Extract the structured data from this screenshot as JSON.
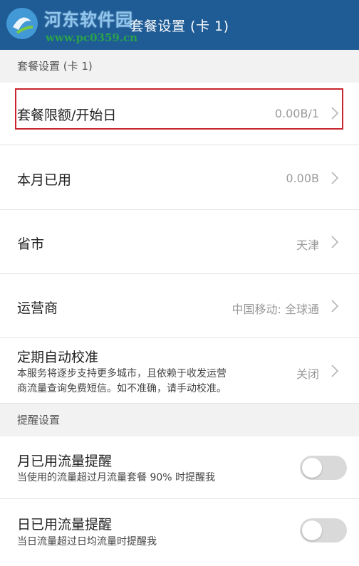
{
  "watermark": {
    "site_name": "河东软件园",
    "url": "www.pc0359.cn"
  },
  "header": {
    "title": "套餐设置 (卡 1)"
  },
  "sections": [
    {
      "header": "套餐设置 (卡 1)"
    },
    {
      "header": "提醒设置"
    }
  ],
  "rows": {
    "limit": {
      "label": "套餐限额/开始日",
      "value": "0.00B/1"
    },
    "used": {
      "label": "本月已用",
      "value": "0.00B"
    },
    "province": {
      "label": "省市",
      "value": "天津"
    },
    "carrier": {
      "label": "运营商",
      "value": "中国移动: 全球通"
    },
    "auto_calibrate": {
      "label": "定期自动校准",
      "desc_line1": "本服务将逐步支持更多城市，且依赖于收发运营",
      "desc_line2": "商流量查询免费短信。如不准确，请手动校准。",
      "value": "关闭"
    },
    "monthly_alert": {
      "label": "月已用流量提醒",
      "desc": "当使用的流量超过月流量套餐 90% 时提醒我",
      "enabled": false
    },
    "daily_alert": {
      "label": "日已用流量提醒",
      "desc": "当日流量超过日均流量时提醒我",
      "enabled": false
    }
  },
  "colors": {
    "topbar": "#1f5c96",
    "highlight_border": "#c8252d",
    "toggle_off": "#d9d9d9"
  }
}
